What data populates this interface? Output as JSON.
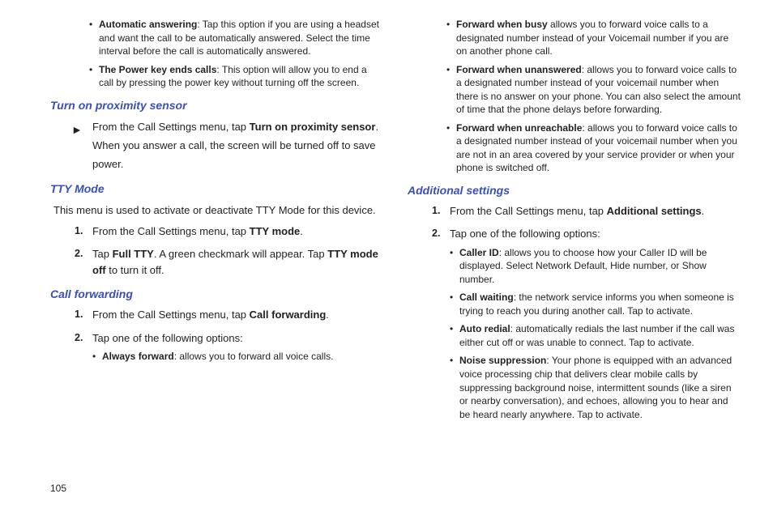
{
  "left": {
    "topBullets": [
      {
        "bold": "Automatic answering",
        "text": ": Tap this option if you are using a headset and want the call to be automatically answered. Select the time interval before the call is automatically answered."
      },
      {
        "bold": "The Power key ends calls",
        "text": ": This option will allow you to end a call by pressing the power key without turning off the screen."
      }
    ],
    "s1": {
      "title": "Turn on proximity sensor",
      "arrowLine1a": "From the Call Settings menu, tap ",
      "arrowLine1b": "Turn on proximity sensor",
      "arrowLine1c": ".",
      "arrowLine2": "When you answer a call, the screen will be turned off to save power."
    },
    "s2": {
      "title": "TTY Mode",
      "intro": "This menu is used to activate or deactivate TTY Mode for this device.",
      "step1a": "From the Call Settings menu, tap ",
      "step1b": "TTY mode",
      "step1c": ".",
      "step2a": "Tap ",
      "step2b": "Full TTY",
      "step2c": ". A green checkmark will appear. Tap ",
      "step2d": "TTY mode off",
      "step2e": " to turn it off."
    },
    "s3": {
      "title": "Call forwarding",
      "step1a": "From the Call Settings menu, tap ",
      "step1b": "Call forwarding",
      "step1c": ".",
      "step2": "Tap one of the following options:",
      "sub": [
        {
          "bold": "Always forward",
          "text": ": allows you to forward all voice calls."
        }
      ]
    }
  },
  "right": {
    "topBullets": [
      {
        "bold": "Forward when busy",
        "text": " allows you to forward voice calls to a designated number instead of your Voicemail number if you are on another phone call."
      },
      {
        "bold": "Forward when unanswered",
        "text": ": allows you to forward voice calls to a designated number instead of your voicemail number when there is no answer on your phone. You can also select the amount of time that the phone delays before forwarding."
      },
      {
        "bold": "Forward when unreachable",
        "text": ": allows you to forward voice calls to a designated number instead of your voicemail number when you are not in an area covered by your service provider or when your phone is switched off."
      }
    ],
    "s1": {
      "title": "Additional settings",
      "step1a": "From the Call Settings menu, tap ",
      "step1b": "Additional settings",
      "step1c": ".",
      "step2": "Tap one of the following options:",
      "sub": [
        {
          "bold": "Caller ID",
          "text": ": allows you to choose how your Caller ID will be displayed. Select Network Default, Hide number, or Show number."
        },
        {
          "bold": "Call waiting",
          "text": ": the network service informs you when someone is trying to reach you during another call. Tap to activate."
        },
        {
          "bold": "Auto redial",
          "text": ": automatically redials the last number if the call was either cut off or was unable to connect. Tap to activate."
        },
        {
          "bold": "Noise suppression",
          "text": ": Your phone is equipped with an advanced voice processing chip that delivers clear mobile calls by suppressing background noise, intermittent sounds (like a siren or nearby conversation), and echoes, allowing you to hear and be heard nearly anywhere. Tap to activate."
        }
      ]
    }
  },
  "pageNumber": "105"
}
